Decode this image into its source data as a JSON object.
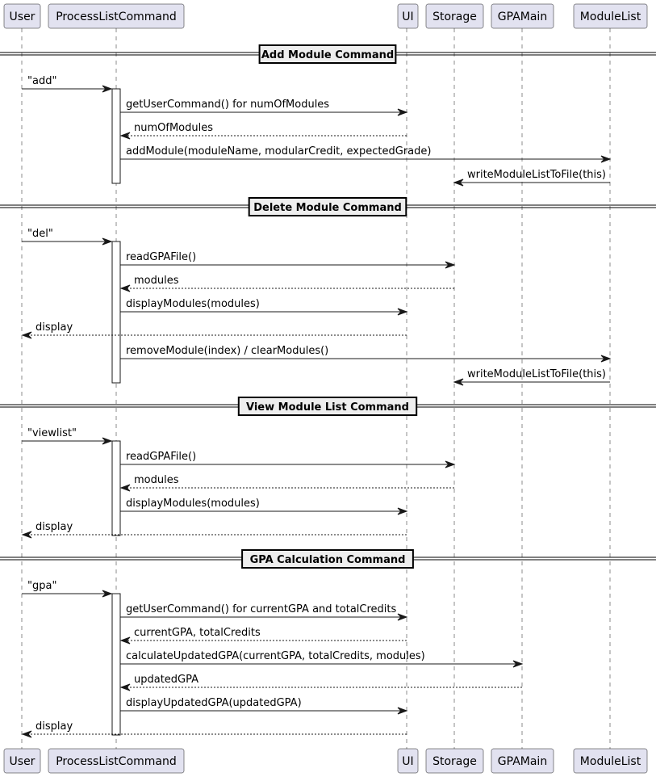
{
  "diagram": {
    "type": "sequence",
    "participants": [
      {
        "id": "user",
        "label": "User"
      },
      {
        "id": "plc",
        "label": "ProcessListCommand"
      },
      {
        "id": "ui",
        "label": "UI"
      },
      {
        "id": "storage",
        "label": "Storage"
      },
      {
        "id": "gpamain",
        "label": "GPAMain"
      },
      {
        "id": "modulelist",
        "label": "ModuleList"
      }
    ],
    "sections": [
      {
        "title": "Add Module Command",
        "messages": [
          {
            "from": "user",
            "to": "plc",
            "label": "\"add\"",
            "style": "solid"
          },
          {
            "from": "plc",
            "to": "ui",
            "label": "getUserCommand() for numOfModules",
            "style": "solid"
          },
          {
            "from": "ui",
            "to": "plc",
            "label": "numOfModules",
            "style": "dashed"
          },
          {
            "from": "plc",
            "to": "modulelist",
            "label": "addModule(moduleName, modularCredit, expectedGrade)",
            "style": "solid"
          },
          {
            "from": "modulelist",
            "to": "storage",
            "label": "writeModuleListToFile(this)",
            "style": "solid"
          }
        ]
      },
      {
        "title": "Delete Module Command",
        "messages": [
          {
            "from": "user",
            "to": "plc",
            "label": "\"del\"",
            "style": "solid"
          },
          {
            "from": "plc",
            "to": "storage",
            "label": "readGPAFile()",
            "style": "solid"
          },
          {
            "from": "storage",
            "to": "plc",
            "label": "modules",
            "style": "dashed"
          },
          {
            "from": "plc",
            "to": "ui",
            "label": "displayModules(modules)",
            "style": "solid"
          },
          {
            "from": "ui",
            "to": "user",
            "label": "display",
            "style": "dashed"
          },
          {
            "from": "plc",
            "to": "modulelist",
            "label": "removeModule(index) / clearModules()",
            "style": "solid"
          },
          {
            "from": "modulelist",
            "to": "storage",
            "label": "writeModuleListToFile(this)",
            "style": "solid"
          }
        ]
      },
      {
        "title": "View Module List Command",
        "messages": [
          {
            "from": "user",
            "to": "plc",
            "label": "\"viewlist\"",
            "style": "solid"
          },
          {
            "from": "plc",
            "to": "storage",
            "label": "readGPAFile()",
            "style": "solid"
          },
          {
            "from": "storage",
            "to": "plc",
            "label": "modules",
            "style": "dashed"
          },
          {
            "from": "plc",
            "to": "ui",
            "label": "displayModules(modules)",
            "style": "solid"
          },
          {
            "from": "ui",
            "to": "user",
            "label": "display",
            "style": "dashed"
          }
        ]
      },
      {
        "title": "GPA Calculation Command",
        "messages": [
          {
            "from": "user",
            "to": "plc",
            "label": "\"gpa\"",
            "style": "solid"
          },
          {
            "from": "plc",
            "to": "ui",
            "label": "getUserCommand() for currentGPA and totalCredits",
            "style": "solid"
          },
          {
            "from": "ui",
            "to": "plc",
            "label": "currentGPA, totalCredits",
            "style": "dashed"
          },
          {
            "from": "plc",
            "to": "gpamain",
            "label": "calculateUpdatedGPA(currentGPA, totalCredits, modules)",
            "style": "solid"
          },
          {
            "from": "gpamain",
            "to": "plc",
            "label": "updatedGPA",
            "style": "dashed"
          },
          {
            "from": "plc",
            "to": "ui",
            "label": "displayUpdatedGPA(updatedGPA)",
            "style": "solid"
          },
          {
            "from": "ui",
            "to": "user",
            "label": "display",
            "style": "dashed"
          }
        ]
      }
    ]
  }
}
